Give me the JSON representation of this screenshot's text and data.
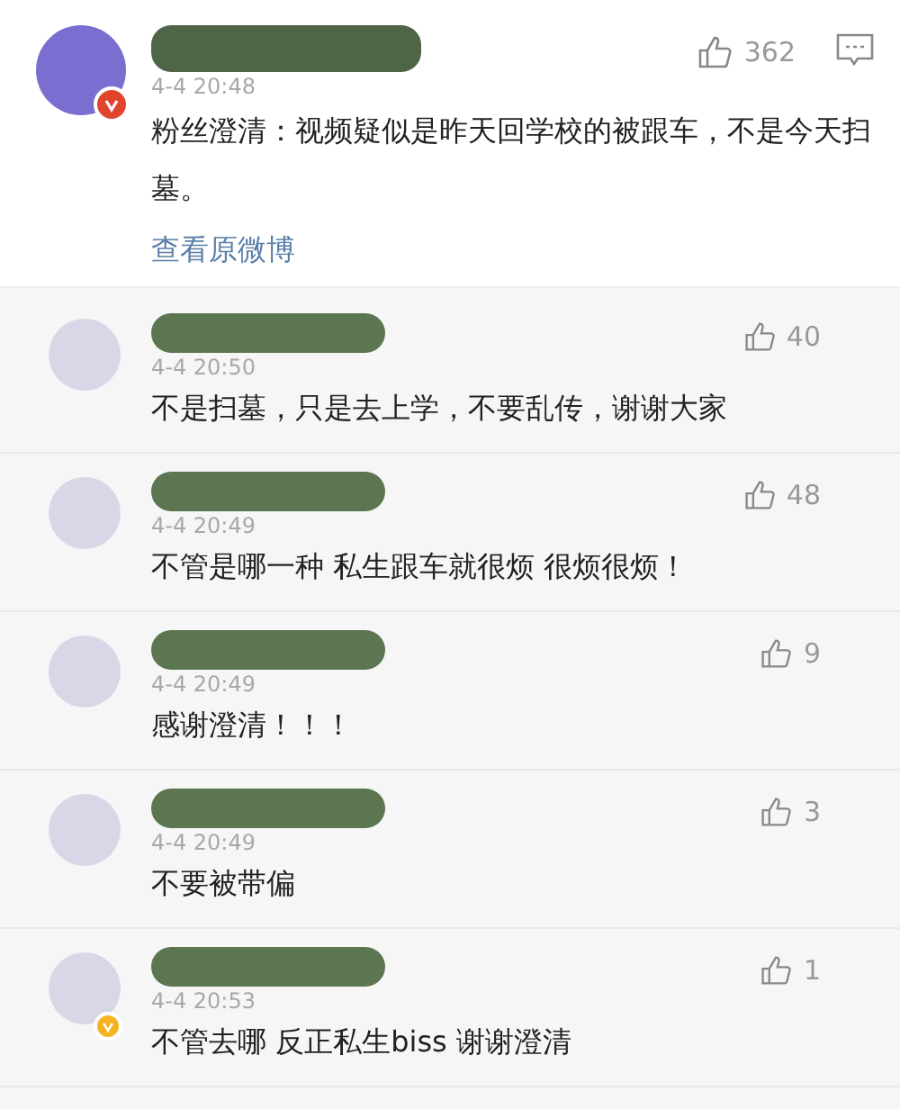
{
  "main_comment": {
    "badge": {
      "color": "#e0442c"
    },
    "time": "4-4 20:48",
    "text": "粉丝澄清：视频疑似是昨天回学校的被跟车，不是今天扫墓。",
    "likes": "362",
    "link": "查看原微博"
  },
  "replies": [
    {
      "time": "4-4 20:50",
      "text": "不是扫墓，只是去上学，不要乱传，谢谢大家",
      "likes": "40"
    },
    {
      "time": "4-4 20:49",
      "text": "不管是哪一种 私生跟车就很烦 很烦很烦！",
      "likes": "48"
    },
    {
      "time": "4-4 20:49",
      "text": "感谢澄清！！！",
      "likes": "9"
    },
    {
      "time": "4-4 20:49",
      "text": "不要被带偏",
      "likes": "3"
    },
    {
      "badge": {
        "color": "#f5b324"
      },
      "time": "4-4 20:53",
      "text": "不管去哪 反正私生biss 谢谢澄清",
      "likes": "1"
    }
  ]
}
